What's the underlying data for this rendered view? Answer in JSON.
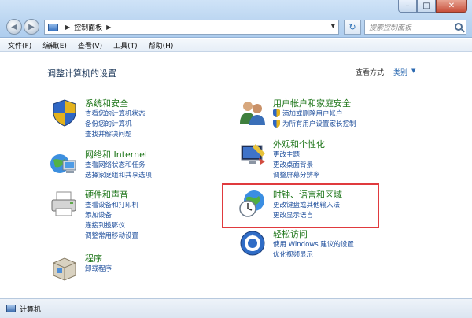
{
  "window": {
    "controls": {
      "minimize": "–",
      "maximize": "□",
      "close": "✕"
    }
  },
  "nav": {
    "back_icon": "back-arrow-icon",
    "forward_icon": "forward-arrow-icon"
  },
  "address": {
    "path": "控制面板"
  },
  "search": {
    "placeholder": "搜索控制面板"
  },
  "menu": {
    "items": [
      "文件(F)",
      "编辑(E)",
      "查看(V)",
      "工具(T)",
      "帮助(H)"
    ]
  },
  "header": {
    "title": "调整计算机的设置",
    "view_by_label": "查看方式:",
    "view_by_value": "类别"
  },
  "categories": [
    {
      "title": "系统和安全",
      "links": [
        "查看您的计算机状态",
        "备份您的计算机",
        "查找并解决问题"
      ]
    },
    {
      "title": "网络和 Internet",
      "links": [
        "查看网络状态和任务",
        "选择家庭组和共享选项"
      ]
    },
    {
      "title": "硬件和声音",
      "links": [
        "查看设备和打印机",
        "添加设备",
        "连接到投影仪",
        "调整常用移动设置"
      ]
    },
    {
      "title": "程序",
      "links": [
        "卸载程序"
      ]
    },
    {
      "title": "用户帐户和家庭安全",
      "links": [
        "添加或删除用户帐户",
        "为所有用户设置家长控制"
      ]
    },
    {
      "title": "外观和个性化",
      "links": [
        "更改主题",
        "更改桌面背景",
        "调整屏幕分辨率"
      ]
    },
    {
      "title": "时钟、语言和区域",
      "links": [
        "更改键盘或其他输入法",
        "更改显示语言"
      ]
    },
    {
      "title": "轻松访问",
      "links": [
        "使用 Windows 建议的设置",
        "优化视频显示"
      ]
    }
  ],
  "status": {
    "text": "计算机"
  },
  "colors": {
    "category_title": "#1d7518",
    "link": "#1f4f9c",
    "highlight": "#e03a3e"
  }
}
